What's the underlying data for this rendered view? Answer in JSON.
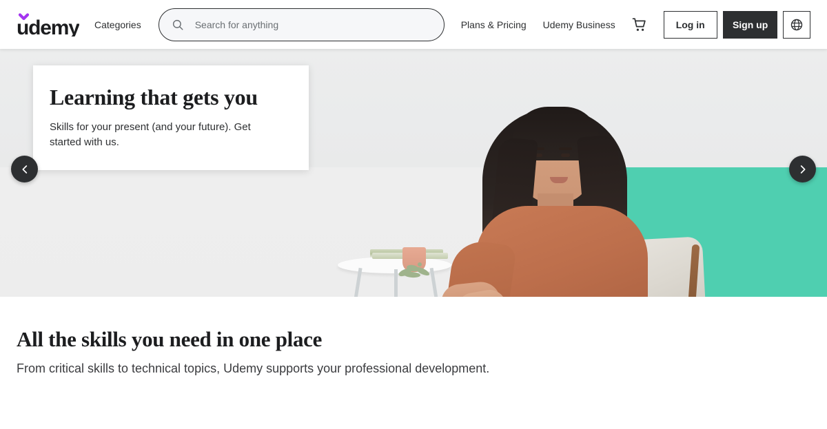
{
  "header": {
    "logo": {
      "name": "udemy",
      "text": "udemy",
      "accent_color": "#A435F0"
    },
    "nav": {
      "categories": "Categories",
      "plans_pricing": "Plans & Pricing",
      "udemy_business": "Udemy Business"
    },
    "search": {
      "placeholder": "Search for anything",
      "value": "",
      "icon": "search-icon"
    },
    "cart": {
      "icon": "shopping-cart-icon",
      "label": "Shopping cart"
    },
    "buttons": {
      "log_in": "Log in",
      "sign_up": "Sign up",
      "language": {
        "icon": "globe-icon",
        "label": "Choose a language"
      }
    },
    "colors": {
      "text": "#2d2f31",
      "signup_bg": "#2d2f31",
      "signup_text": "#ffffff"
    }
  },
  "hero": {
    "card": {
      "title": "Learning that gets you",
      "subtitle": "Skills for your present (and your future). Get started with us."
    },
    "carousel": {
      "prev_icon": "chevron-left-icon",
      "prev_label": "Previous",
      "next_icon": "chevron-right-icon",
      "next_label": "Next"
    },
    "image": {
      "description": "Woman in a rust-colored dress seated in a wooden armchair beside a white side table with books and a potted succulent",
      "wall_color": "#eceded",
      "accent_color": "#4fcfb0",
      "dress_color": "#bd6f4c"
    }
  },
  "section": {
    "title": "All the skills you need in one place",
    "subtitle": "From critical skills to technical topics, Udemy supports your professional development."
  }
}
